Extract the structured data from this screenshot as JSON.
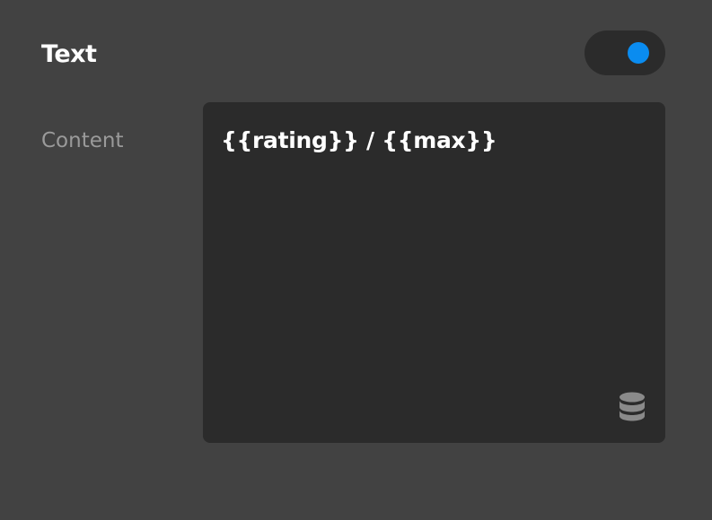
{
  "panel": {
    "title": "Text",
    "enabled": true
  },
  "content_field": {
    "label": "Content",
    "value": "{{rating}} / {{max}}",
    "source_icon": "database-icon"
  },
  "colors": {
    "background": "#424242",
    "field_background": "#2b2b2b",
    "accent": "#0a8cf0",
    "label_color": "#9a9a9a"
  }
}
